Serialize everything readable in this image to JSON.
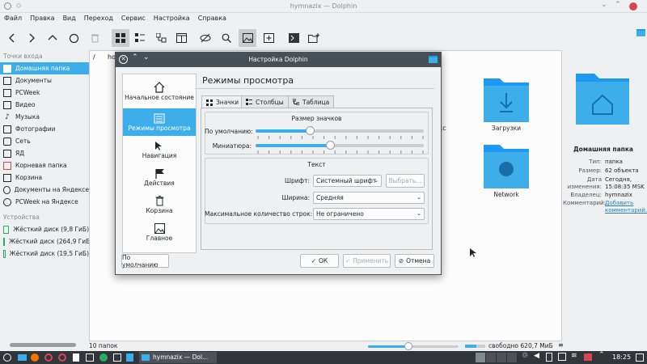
{
  "window": {
    "title": "hymnazix — Dolphin"
  },
  "menu": [
    "Файл",
    "Правка",
    "Вид",
    "Переход",
    "Сервис",
    "Настройка",
    "Справка"
  ],
  "sidebar": {
    "places_header": "Точки входа",
    "places": [
      "Домашняя папка",
      "Документы",
      "PCWeek",
      "Видео",
      "Музыка",
      "Фотографии",
      "Сеть",
      "ЯД",
      "Корневая папка",
      "Корзина",
      "Документы на Яндексе",
      "PCWeek на Яндексе"
    ],
    "devices_header": "Устройства",
    "devices": [
      "Жёсткий диск (9,8 ГиБ)",
      "Жёсткий диск (264,9 ГиБ)",
      "Жёсткий диск (19,5 ГиБ)"
    ]
  },
  "breadcrumb": {
    "sep": "/",
    "item": "ho"
  },
  "content": {
    "partial_label": "экс",
    "folders": [
      "Загрузки",
      "Network"
    ]
  },
  "info": {
    "title": "Домашняя папка",
    "rows": [
      {
        "k": "Тип:",
        "v": "папка"
      },
      {
        "k": "Размер:",
        "v": "62 объекта"
      },
      {
        "k": "Дата изменения:",
        "v": "Сегодня, 15:08:35 MSK"
      },
      {
        "k": "Владелец:",
        "v": "hymnazix"
      },
      {
        "k": "Комментарий:",
        "v": "Добавить комментарий..."
      }
    ]
  },
  "statusbar": {
    "count": "10 папок",
    "free": "свободно 620,7 МиБ",
    "zoom_fraction": 0.45,
    "free_fraction": 0.55
  },
  "dialog": {
    "title": "Настройка Dolphin",
    "nav": [
      "Начальное состояние",
      "Режимы просмотра",
      "Навигация",
      "Действия",
      "Корзина",
      "Главное"
    ],
    "page_title": "Режимы просмотра",
    "tabs": [
      "Значки",
      "Столбцы",
      "Таблица"
    ],
    "icon_size": {
      "header": "Размер значков",
      "default_label": "По умолчанию:",
      "preview_label": "Миниатюра:",
      "default_value": 0.32,
      "preview_value": 0.44
    },
    "text": {
      "header": "Текст",
      "font_label": "Шрифт:",
      "font_value": "Системный шрифт",
      "choose_btn": "Выбрать...",
      "width_label": "Ширина:",
      "width_value": "Средняя",
      "maxlines_label": "Максимальное количество строк:",
      "maxlines_value": "Не ограничено"
    },
    "buttons": {
      "defaults": "По умолчанию",
      "ok": "ОК",
      "apply": "Применить",
      "cancel": "Отмена"
    }
  },
  "taskbar": {
    "task": "hymnazix — Dol...",
    "time": "18:25"
  }
}
